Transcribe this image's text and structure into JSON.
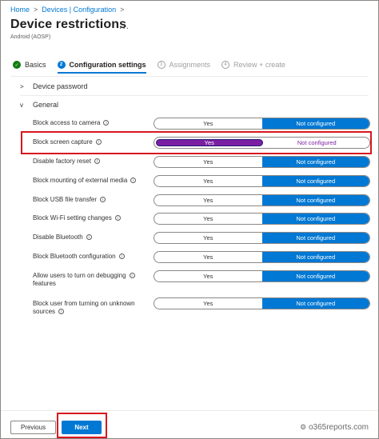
{
  "breadcrumb": {
    "home": "Home",
    "sep": ">",
    "devices": "Devices | Configuration"
  },
  "header": {
    "title": "Device restrictions",
    "more": "...",
    "subtitle": "Android (AOSP)"
  },
  "steps": [
    {
      "icon": "✓",
      "label": "Basics",
      "state": "done"
    },
    {
      "icon": "2",
      "label": "Configuration settings",
      "state": "current"
    },
    {
      "icon": "3",
      "label": "Assignments",
      "state": "pending"
    },
    {
      "icon": "4",
      "label": "Review + create",
      "state": "pending"
    }
  ],
  "sections": {
    "device_password": "Device password",
    "general": "General",
    "collapsed_chevron": ">",
    "expanded_chevron": "v"
  },
  "toggle_options": {
    "yes": "Yes",
    "not_configured": "Not configured"
  },
  "settings": [
    {
      "label": "Block access to camera",
      "selected": "Not configured"
    },
    {
      "label": "Block screen capture",
      "selected": "Yes"
    },
    {
      "label": "Disable factory reset",
      "selected": "Not configured"
    },
    {
      "label": "Block mounting of external media",
      "selected": "Not configured"
    },
    {
      "label": "Block USB file transfer",
      "selected": "Not configured"
    },
    {
      "label": "Block Wi-Fi setting changes",
      "selected": "Not configured"
    },
    {
      "label": "Disable Bluetooth",
      "selected": "Not configured"
    },
    {
      "label": "Block Bluetooth configuration",
      "selected": "Not configured"
    },
    {
      "label_line1": "Allow users to turn on debugging",
      "label_line2": "features",
      "selected": "Not configured"
    },
    {
      "label_line1": "Block user from turning on unknown",
      "label_line2": "sources",
      "selected": "Not configured"
    }
  ],
  "info_glyph": "i",
  "footer": {
    "previous": "Previous",
    "next": "Next"
  },
  "watermark": {
    "icon": "⚙",
    "text": "o365reports.com"
  },
  "colors": {
    "accent": "#0078d4",
    "highlight": "#d9171e",
    "selected_purple": "#7a1fa2",
    "done_green": "#107c10"
  }
}
